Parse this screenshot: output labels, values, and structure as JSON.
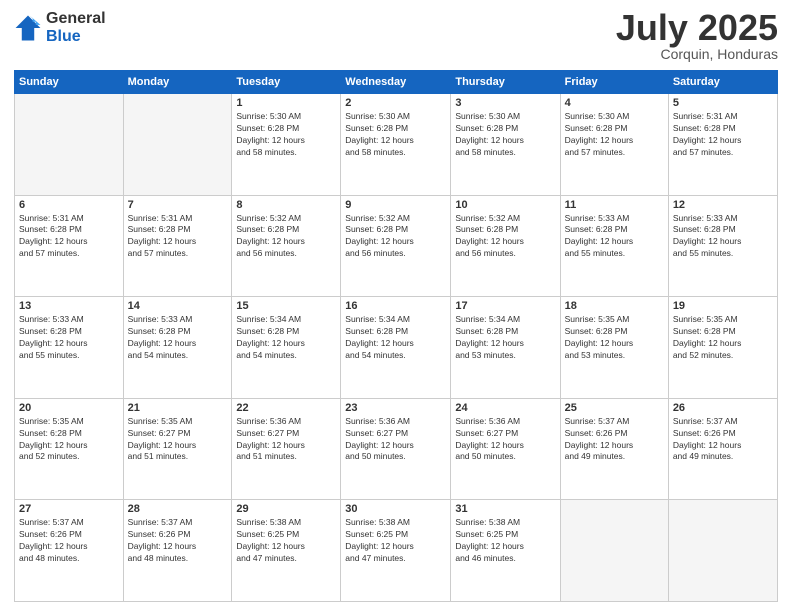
{
  "logo": {
    "general": "General",
    "blue": "Blue"
  },
  "header": {
    "month": "July 2025",
    "location": "Corquin, Honduras"
  },
  "weekdays": [
    "Sunday",
    "Monday",
    "Tuesday",
    "Wednesday",
    "Thursday",
    "Friday",
    "Saturday"
  ],
  "weeks": [
    [
      {
        "day": "",
        "empty": true
      },
      {
        "day": "",
        "empty": true
      },
      {
        "day": "1",
        "sunrise": "5:30 AM",
        "sunset": "6:28 PM",
        "daylight": "12 hours and 58 minutes."
      },
      {
        "day": "2",
        "sunrise": "5:30 AM",
        "sunset": "6:28 PM",
        "daylight": "12 hours and 58 minutes."
      },
      {
        "day": "3",
        "sunrise": "5:30 AM",
        "sunset": "6:28 PM",
        "daylight": "12 hours and 58 minutes."
      },
      {
        "day": "4",
        "sunrise": "5:30 AM",
        "sunset": "6:28 PM",
        "daylight": "12 hours and 57 minutes."
      },
      {
        "day": "5",
        "sunrise": "5:31 AM",
        "sunset": "6:28 PM",
        "daylight": "12 hours and 57 minutes."
      }
    ],
    [
      {
        "day": "6",
        "sunrise": "5:31 AM",
        "sunset": "6:28 PM",
        "daylight": "12 hours and 57 minutes."
      },
      {
        "day": "7",
        "sunrise": "5:31 AM",
        "sunset": "6:28 PM",
        "daylight": "12 hours and 57 minutes."
      },
      {
        "day": "8",
        "sunrise": "5:32 AM",
        "sunset": "6:28 PM",
        "daylight": "12 hours and 56 minutes."
      },
      {
        "day": "9",
        "sunrise": "5:32 AM",
        "sunset": "6:28 PM",
        "daylight": "12 hours and 56 minutes."
      },
      {
        "day": "10",
        "sunrise": "5:32 AM",
        "sunset": "6:28 PM",
        "daylight": "12 hours and 56 minutes."
      },
      {
        "day": "11",
        "sunrise": "5:33 AM",
        "sunset": "6:28 PM",
        "daylight": "12 hours and 55 minutes."
      },
      {
        "day": "12",
        "sunrise": "5:33 AM",
        "sunset": "6:28 PM",
        "daylight": "12 hours and 55 minutes."
      }
    ],
    [
      {
        "day": "13",
        "sunrise": "5:33 AM",
        "sunset": "6:28 PM",
        "daylight": "12 hours and 55 minutes."
      },
      {
        "day": "14",
        "sunrise": "5:33 AM",
        "sunset": "6:28 PM",
        "daylight": "12 hours and 54 minutes."
      },
      {
        "day": "15",
        "sunrise": "5:34 AM",
        "sunset": "6:28 PM",
        "daylight": "12 hours and 54 minutes."
      },
      {
        "day": "16",
        "sunrise": "5:34 AM",
        "sunset": "6:28 PM",
        "daylight": "12 hours and 54 minutes."
      },
      {
        "day": "17",
        "sunrise": "5:34 AM",
        "sunset": "6:28 PM",
        "daylight": "12 hours and 53 minutes."
      },
      {
        "day": "18",
        "sunrise": "5:35 AM",
        "sunset": "6:28 PM",
        "daylight": "12 hours and 53 minutes."
      },
      {
        "day": "19",
        "sunrise": "5:35 AM",
        "sunset": "6:28 PM",
        "daylight": "12 hours and 52 minutes."
      }
    ],
    [
      {
        "day": "20",
        "sunrise": "5:35 AM",
        "sunset": "6:28 PM",
        "daylight": "12 hours and 52 minutes."
      },
      {
        "day": "21",
        "sunrise": "5:35 AM",
        "sunset": "6:27 PM",
        "daylight": "12 hours and 51 minutes."
      },
      {
        "day": "22",
        "sunrise": "5:36 AM",
        "sunset": "6:27 PM",
        "daylight": "12 hours and 51 minutes."
      },
      {
        "day": "23",
        "sunrise": "5:36 AM",
        "sunset": "6:27 PM",
        "daylight": "12 hours and 50 minutes."
      },
      {
        "day": "24",
        "sunrise": "5:36 AM",
        "sunset": "6:27 PM",
        "daylight": "12 hours and 50 minutes."
      },
      {
        "day": "25",
        "sunrise": "5:37 AM",
        "sunset": "6:26 PM",
        "daylight": "12 hours and 49 minutes."
      },
      {
        "day": "26",
        "sunrise": "5:37 AM",
        "sunset": "6:26 PM",
        "daylight": "12 hours and 49 minutes."
      }
    ],
    [
      {
        "day": "27",
        "sunrise": "5:37 AM",
        "sunset": "6:26 PM",
        "daylight": "12 hours and 48 minutes."
      },
      {
        "day": "28",
        "sunrise": "5:37 AM",
        "sunset": "6:26 PM",
        "daylight": "12 hours and 48 minutes."
      },
      {
        "day": "29",
        "sunrise": "5:38 AM",
        "sunset": "6:25 PM",
        "daylight": "12 hours and 47 minutes."
      },
      {
        "day": "30",
        "sunrise": "5:38 AM",
        "sunset": "6:25 PM",
        "daylight": "12 hours and 47 minutes."
      },
      {
        "day": "31",
        "sunrise": "5:38 AM",
        "sunset": "6:25 PM",
        "daylight": "12 hours and 46 minutes."
      },
      {
        "day": "",
        "empty": true
      },
      {
        "day": "",
        "empty": true
      }
    ]
  ]
}
